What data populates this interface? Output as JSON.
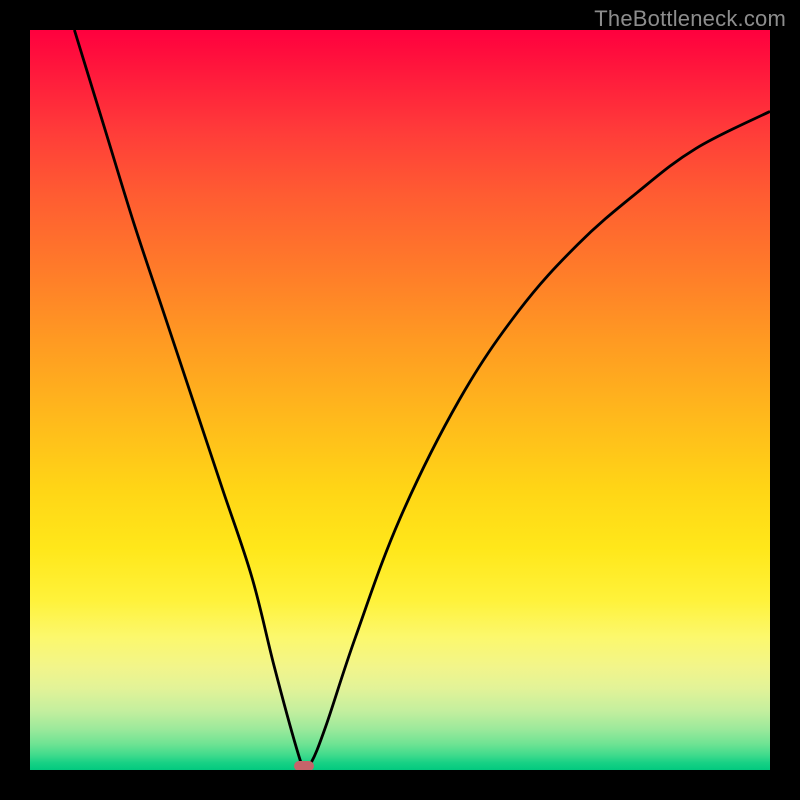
{
  "attribution": "TheBottleneck.com",
  "colors": {
    "frame_background": "#000000",
    "attribution_text": "#8d8d8d",
    "curve_stroke": "#000000",
    "marker_fill": "#c5646a",
    "gradient_stops": [
      {
        "stop": 0.0,
        "color": "#ff003e"
      },
      {
        "stop": 0.06,
        "color": "#ff1a3c"
      },
      {
        "stop": 0.14,
        "color": "#ff3d39"
      },
      {
        "stop": 0.22,
        "color": "#ff5b32"
      },
      {
        "stop": 0.32,
        "color": "#ff7a2a"
      },
      {
        "stop": 0.42,
        "color": "#ff9a22"
      },
      {
        "stop": 0.52,
        "color": "#ffb81c"
      },
      {
        "stop": 0.62,
        "color": "#ffd516"
      },
      {
        "stop": 0.7,
        "color": "#ffe71a"
      },
      {
        "stop": 0.77,
        "color": "#fff23a"
      },
      {
        "stop": 0.82,
        "color": "#fcf86c"
      },
      {
        "stop": 0.86,
        "color": "#f2f58a"
      },
      {
        "stop": 0.89,
        "color": "#e2f398"
      },
      {
        "stop": 0.92,
        "color": "#c4ef9e"
      },
      {
        "stop": 0.945,
        "color": "#9be99b"
      },
      {
        "stop": 0.965,
        "color": "#6ee393"
      },
      {
        "stop": 0.98,
        "color": "#3fdb8c"
      },
      {
        "stop": 0.99,
        "color": "#18d185"
      },
      {
        "stop": 1.0,
        "color": "#02c97f"
      }
    ]
  },
  "chart_data": {
    "type": "line",
    "title": "",
    "xlabel": "",
    "ylabel": "",
    "xlim": [
      0,
      100
    ],
    "ylim": [
      0,
      100
    ],
    "x": [
      6,
      10,
      14,
      18,
      22,
      26,
      30,
      33,
      36,
      37,
      38,
      40,
      44,
      50,
      58,
      66,
      74,
      82,
      90,
      100
    ],
    "values": [
      100,
      87,
      74,
      62,
      50,
      38,
      26,
      14,
      3,
      0.5,
      1,
      6,
      18,
      34,
      50,
      62,
      71,
      78,
      84,
      89
    ],
    "min_point": {
      "x": 37,
      "y": 0.5
    }
  }
}
